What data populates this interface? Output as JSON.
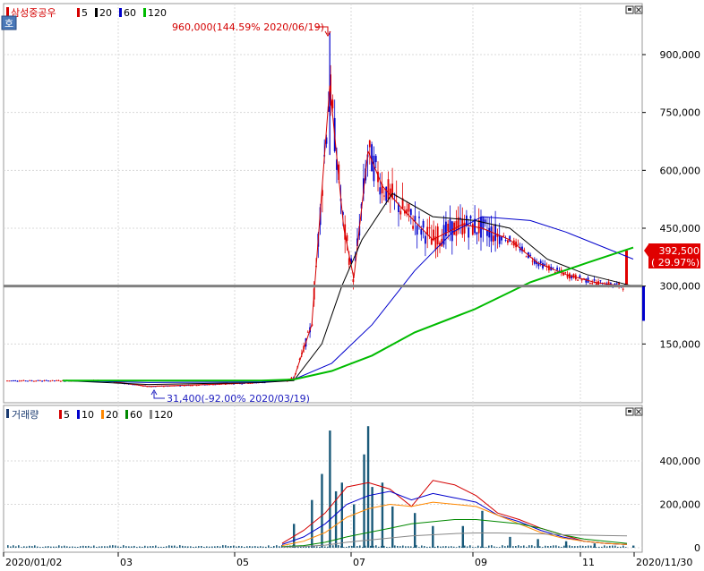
{
  "price_panel": {
    "stock_name": "삼성중공우",
    "legend": [
      {
        "label": "5",
        "color": "#d40000"
      },
      {
        "label": "20",
        "color": "#000000"
      },
      {
        "label": "60",
        "color": "#0000cc"
      },
      {
        "label": "120",
        "color": "#00bb00"
      }
    ],
    "mode_icon_label": "호",
    "high_annotation": "960,000(144.59% 2020/06/19)",
    "low_annotation": "31,400(-92.00% 2020/03/19)",
    "current_price_label": "392,500",
    "current_change_label": "( 29.97%)",
    "y_tick_labels": [
      "900,000",
      "750,000",
      "600,000",
      "450,000",
      "300,000",
      "150,000"
    ]
  },
  "volume_panel": {
    "title": "거래량",
    "legend": [
      {
        "label": "5",
        "color": "#d40000"
      },
      {
        "label": "10",
        "color": "#0000cc"
      },
      {
        "label": "20",
        "color": "#ff8800"
      },
      {
        "label": "60",
        "color": "#008800"
      },
      {
        "label": "120",
        "color": "#888888"
      }
    ],
    "y_tick_labels": [
      "400,000",
      "200,000",
      "0"
    ]
  },
  "x_axis_labels": [
    "2020/01/02",
    "03",
    "05",
    "07",
    "09",
    "11",
    "2020/11/30"
  ],
  "chart_data": [
    {
      "type": "candlestick",
      "title": "삼성중공우",
      "ylim": [
        0,
        1000000
      ],
      "y_ticks": [
        150000,
        300000,
        450000,
        600000,
        750000,
        900000
      ],
      "reference_line": 300000,
      "high": {
        "value": 960000,
        "change_pct": 144.59,
        "date": "2020/06/19"
      },
      "low": {
        "value": 31400,
        "change_pct": -92.0,
        "date": "2020/03/19"
      },
      "last": {
        "value": 392500,
        "change_pct": 29.97
      },
      "x_labels": [
        "2020/01/02",
        "03",
        "05",
        "07",
        "09",
        "11",
        "2020/11/30"
      ],
      "series": [
        {
          "name": "5",
          "x": [
            "01",
            "02",
            "03",
            "04",
            "05",
            "06/01",
            "06/10",
            "06/19",
            "06/26",
            "07/01",
            "07/08",
            "07/15",
            "07/25",
            "08/10",
            "08/25",
            "09/05",
            "09/20",
            "10/05",
            "10/20",
            "11/05",
            "11/20"
          ],
          "values": [
            55000,
            55000,
            40000,
            45000,
            50000,
            60000,
            200000,
            820000,
            450000,
            320000,
            650000,
            560000,
            500000,
            420000,
            460000,
            450000,
            420000,
            360000,
            330000,
            310000,
            300000
          ]
        },
        {
          "name": "20",
          "x": [
            "01",
            "03",
            "05",
            "06/01",
            "06/15",
            "06/25",
            "07/05",
            "07/20",
            "08/10",
            "09/01",
            "09/20",
            "10/10",
            "11/01",
            "11/25"
          ],
          "values": [
            55000,
            45000,
            50000,
            55000,
            150000,
            300000,
            420000,
            540000,
            480000,
            470000,
            450000,
            370000,
            330000,
            300000
          ]
        },
        {
          "name": "60",
          "x": [
            "01",
            "03",
            "05",
            "06/01",
            "06/20",
            "07/10",
            "08/01",
            "08/20",
            "09/05",
            "10/01",
            "10/20",
            "11/25"
          ],
          "values": [
            55000,
            50000,
            52000,
            58000,
            100000,
            200000,
            340000,
            440000,
            480000,
            470000,
            440000,
            370000
          ]
        },
        {
          "name": "120",
          "x": [
            "01",
            "03",
            "05",
            "06/01",
            "06/20",
            "07/10",
            "08/01",
            "09/01",
            "10/01",
            "11/01",
            "11/25"
          ],
          "values": [
            55000,
            55000,
            55000,
            58000,
            80000,
            120000,
            180000,
            240000,
            310000,
            360000,
            400000
          ]
        }
      ]
    },
    {
      "type": "bar",
      "title": "거래량",
      "ylim": [
        0,
        560000
      ],
      "y_ticks": [
        0,
        200000,
        400000
      ],
      "x": [
        "06/01",
        "06/10",
        "06/15",
        "06/19",
        "06/22",
        "06/25",
        "07/01",
        "07/06",
        "07/08",
        "07/10",
        "07/15",
        "07/20",
        "08/01",
        "08/10",
        "08/25",
        "09/05",
        "09/20",
        "10/05",
        "10/20",
        "11/05",
        "11/25"
      ],
      "values": [
        110000,
        220000,
        340000,
        540000,
        260000,
        300000,
        200000,
        430000,
        560000,
        280000,
        300000,
        190000,
        160000,
        100000,
        100000,
        170000,
        50000,
        40000,
        30000,
        20000,
        10000
      ],
      "series": [
        {
          "name": "5",
          "values": [
            20000,
            80000,
            160000,
            280000,
            300000,
            270000,
            190000,
            310000,
            290000,
            240000,
            160000,
            130000,
            90000,
            60000,
            30000,
            20000,
            15000
          ]
        },
        {
          "name": "10",
          "values": [
            15000,
            50000,
            110000,
            200000,
            240000,
            260000,
            220000,
            250000,
            230000,
            210000,
            150000,
            120000,
            80000,
            50000,
            30000,
            20000,
            15000
          ]
        },
        {
          "name": "20",
          "values": [
            10000,
            30000,
            70000,
            140000,
            180000,
            200000,
            190000,
            210000,
            200000,
            190000,
            150000,
            110000,
            70000,
            45000,
            30000,
            20000,
            15000
          ]
        },
        {
          "name": "60",
          "values": [
            5000,
            10000,
            25000,
            50000,
            70000,
            90000,
            110000,
            120000,
            130000,
            130000,
            120000,
            110000,
            90000,
            60000,
            40000,
            30000,
            20000
          ]
        },
        {
          "name": "120",
          "values": [
            3000,
            6000,
            12000,
            25000,
            35000,
            45000,
            55000,
            60000,
            65000,
            68000,
            68000,
            66000,
            64000,
            60000,
            58000,
            56000,
            55000
          ]
        }
      ]
    }
  ]
}
